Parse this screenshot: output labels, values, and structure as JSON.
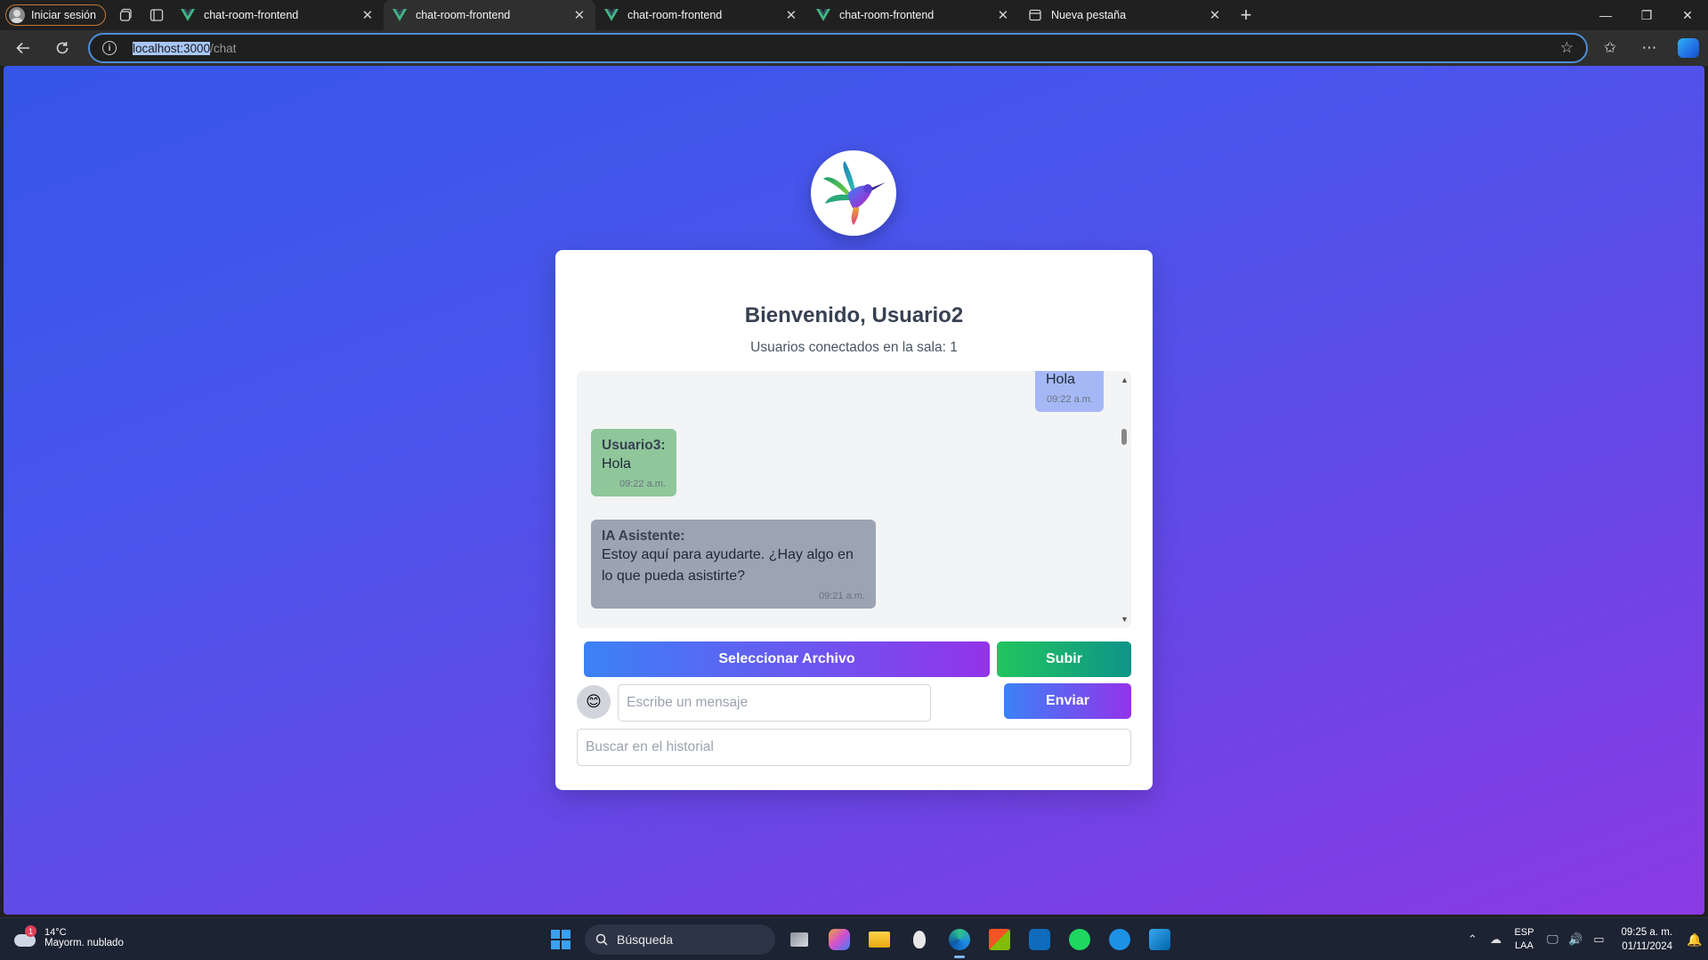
{
  "browser": {
    "profile_label": "Iniciar sesión",
    "tabs": [
      {
        "title": "chat-room-frontend",
        "active": false
      },
      {
        "title": "chat-room-frontend",
        "active": true
      },
      {
        "title": "chat-room-frontend",
        "active": false
      },
      {
        "title": "chat-room-frontend",
        "active": false
      },
      {
        "title": "Nueva pestaña",
        "active": false
      }
    ],
    "url_host": "localhost:3000",
    "url_path": "/chat"
  },
  "page": {
    "title": "Bienvenido, Usuario2",
    "connected_users": "Usuarios conectados en la sala: 1",
    "messages": [
      {
        "author": "",
        "text": "Hola",
        "time": "09:22 a.m."
      },
      {
        "author": "Usuario3:",
        "text": "Hola",
        "time": "09:22 a.m."
      },
      {
        "author": "IA Asistente:",
        "text": "Estoy aquí para ayudarte. ¿Hay algo en lo que pueda asistirte?",
        "time": "09:21 a.m."
      }
    ],
    "select_file_label": "Seleccionar Archivo",
    "upload_label": "Subir",
    "emoji_button": "😊",
    "message_placeholder": "Escribe un mensaje",
    "send_label": "Enviar",
    "search_placeholder": "Buscar en el historial"
  },
  "taskbar": {
    "weather_temp": "14°C",
    "weather_desc": "Mayorm. nublado",
    "weather_badge": "1",
    "search_label": "Búsqueda",
    "lang_top": "ESP",
    "lang_bottom": "LAA",
    "time": "09:25 a. m.",
    "date": "01/11/2024"
  },
  "colors": {
    "page_gradient_start": "#3556e8",
    "page_gradient_end": "#8b3be4",
    "own_message": "#a5b8f5",
    "other_message": "#8fc79a",
    "ai_message": "#9ca3b2",
    "upload_button": "#22c55e"
  }
}
